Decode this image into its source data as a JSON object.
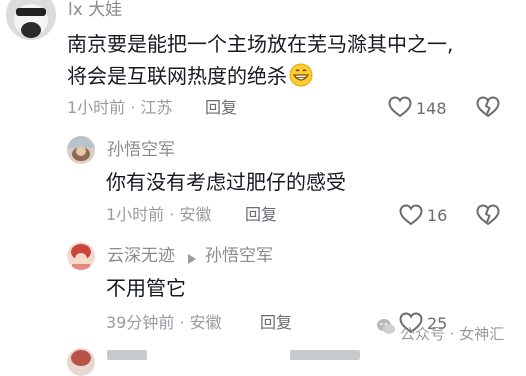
{
  "comments": [
    {
      "username": "lx 大娃",
      "text_lines": [
        "南京要是能把一个主场放在芜马滁其中之一,",
        "将会是互联网热度的绝杀"
      ],
      "time_location": "1小时前 · 江苏",
      "reply_label": "回复",
      "like_count": "148"
    },
    {
      "username": "孙悟空军",
      "text": "你有没有考虑过肥仔的感受",
      "time_location": "1小时前 · 安徽",
      "reply_label": "回复",
      "like_count": "16"
    },
    {
      "username": "云深无迹",
      "reply_to": "孙悟空军",
      "text": "不用管它",
      "time_location": "39分钟前 · 安徽",
      "reply_label": "回复",
      "like_count": "25"
    }
  ],
  "watermark": {
    "text": "公众号 · 女神汇",
    "icon": "wechat-icon"
  },
  "icons": {
    "like": "heart-outline-icon",
    "dislike": "broken-heart-icon",
    "reply_arrow": "triangle-right-icon",
    "emoji": "grinning-face-icon"
  },
  "colors": {
    "text": "#161823",
    "secondary": "#8a8b91",
    "meta": "#9a9ba1"
  }
}
